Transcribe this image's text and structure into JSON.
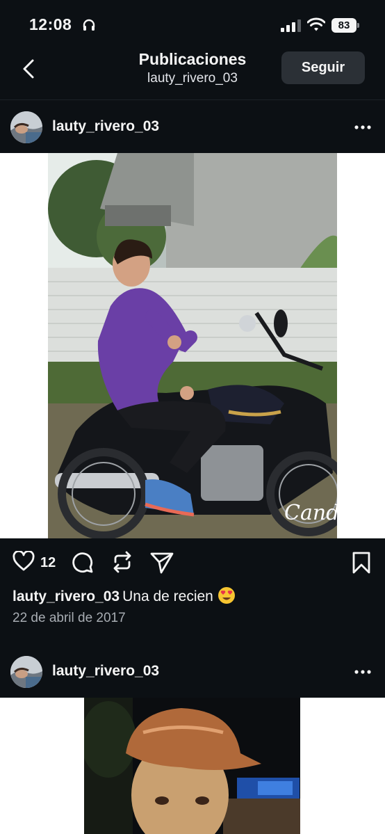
{
  "status_bar": {
    "time": "12:08",
    "battery": "83"
  },
  "header": {
    "title": "Publicaciones",
    "subtitle": "lauty_rivero_03",
    "follow_label": "Seguir"
  },
  "posts": [
    {
      "username": "lauty_rivero_03",
      "likes": "12",
      "caption_user": "lauty_rivero_03",
      "caption_text": "Una de recien",
      "date": "22 de abril de 2017",
      "watermark": "Candy"
    },
    {
      "username": "lauty_rivero_03"
    }
  ],
  "icons": {
    "back": "chevron-left-icon",
    "more": "more-horizontal-icon",
    "like": "heart-icon",
    "comment": "comment-icon",
    "repost": "repost-icon",
    "share": "send-icon",
    "save": "bookmark-icon",
    "emoji": "heart-eyes-emoji-icon"
  },
  "colors": {
    "background": "#0c1014",
    "button": "#2b3036",
    "secondary_text": "#a8adb3"
  }
}
